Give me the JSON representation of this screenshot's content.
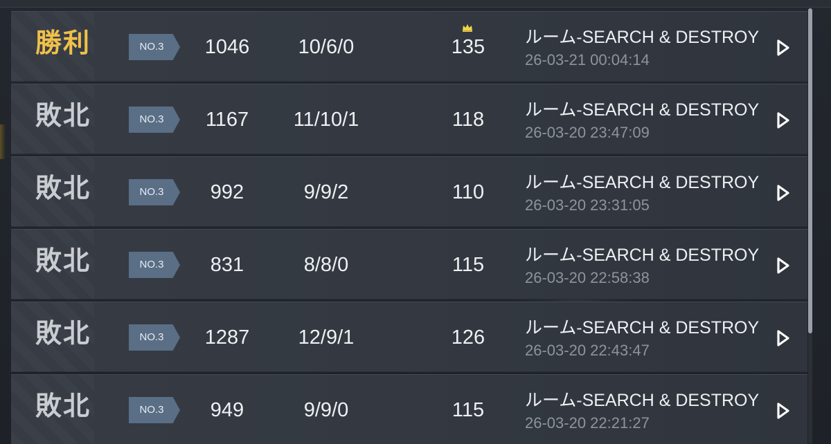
{
  "colors": {
    "win": "#f0c04a",
    "loss": "#c9ccd1",
    "badge": "#5a6e86",
    "subtext": "#8e949c"
  },
  "matches": [
    {
      "result": "勝利",
      "outcome": "win",
      "rank": "NO.3",
      "score": "1046",
      "kda": "10/6/0",
      "points": "135",
      "crown": true,
      "mode": "ルーム-SEARCH & DESTROY",
      "time": "26-03-21 00:04:14"
    },
    {
      "result": "敗北",
      "outcome": "loss",
      "rank": "NO.3",
      "score": "1167",
      "kda": "11/10/1",
      "points": "118",
      "crown": false,
      "mode": "ルーム-SEARCH & DESTROY",
      "time": "26-03-20 23:47:09"
    },
    {
      "result": "敗北",
      "outcome": "loss",
      "rank": "NO.3",
      "score": "992",
      "kda": "9/9/2",
      "points": "110",
      "crown": false,
      "mode": "ルーム-SEARCH & DESTROY",
      "time": "26-03-20 23:31:05"
    },
    {
      "result": "敗北",
      "outcome": "loss",
      "rank": "NO.3",
      "score": "831",
      "kda": "8/8/0",
      "points": "115",
      "crown": false,
      "mode": "ルーム-SEARCH & DESTROY",
      "time": "26-03-20 22:58:38"
    },
    {
      "result": "敗北",
      "outcome": "loss",
      "rank": "NO.3",
      "score": "1287",
      "kda": "12/9/1",
      "points": "126",
      "crown": false,
      "mode": "ルーム-SEARCH & DESTROY",
      "time": "26-03-20 22:43:47"
    },
    {
      "result": "敗北",
      "outcome": "loss",
      "rank": "NO.3",
      "score": "949",
      "kda": "9/9/0",
      "points": "115",
      "crown": false,
      "mode": "ルーム-SEARCH & DESTROY",
      "time": "26-03-20 22:21:27"
    }
  ]
}
